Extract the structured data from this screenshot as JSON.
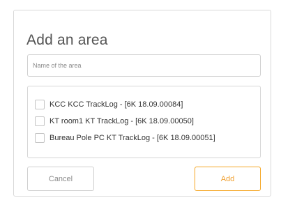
{
  "dialog": {
    "title": "Add an area",
    "name_input": {
      "placeholder": "Name of the area",
      "value": ""
    },
    "devices": [
      {
        "label": "KCC KCC TrackLog - [6K 18.09.00084]",
        "checked": false
      },
      {
        "label": "KT room1 KT TrackLog - [6K 18.09.00050]",
        "checked": false
      },
      {
        "label": "Bureau Pole PC KT TrackLog - [6K 18.09.00051]",
        "checked": false
      }
    ],
    "cancel_label": "Cancel",
    "add_label": "Add"
  },
  "colors": {
    "accent": "#f5a623",
    "border": "#d6d6d6",
    "text": "#333333",
    "muted": "#8a8a8a"
  }
}
